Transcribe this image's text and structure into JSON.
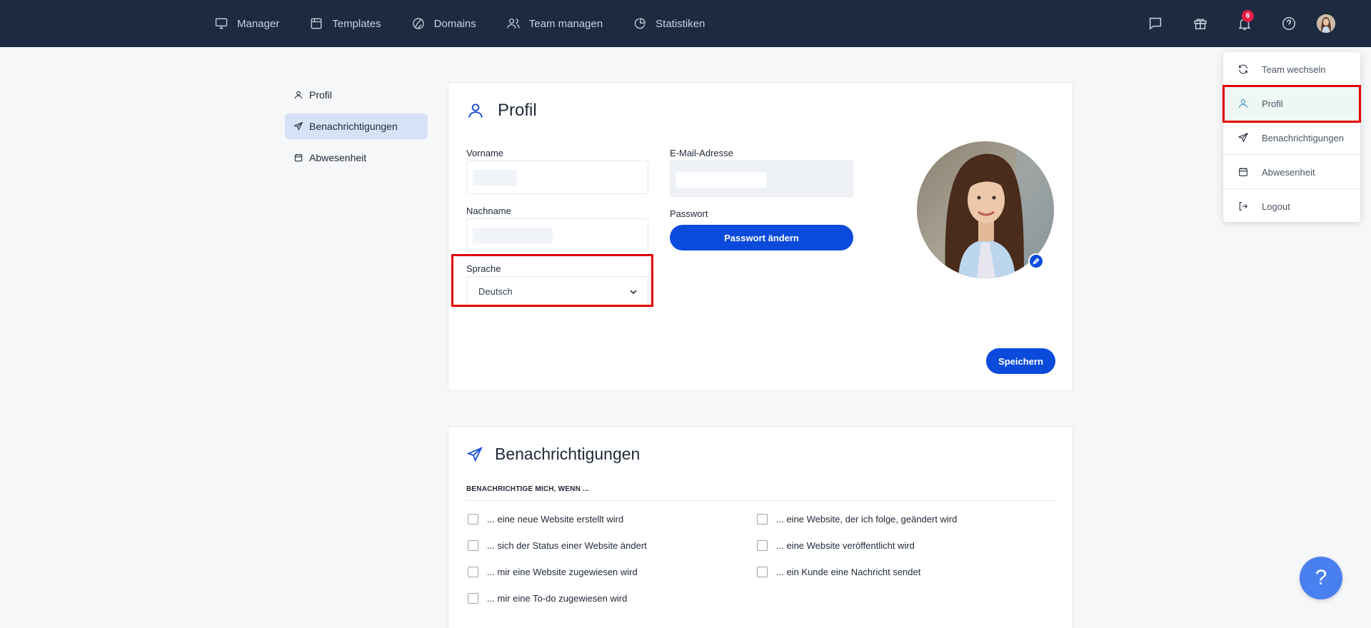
{
  "nav": {
    "items": [
      {
        "label": "Manager",
        "icon": "monitor-icon"
      },
      {
        "label": "Templates",
        "icon": "browser-window-icon"
      },
      {
        "label": "Domains",
        "icon": "globe-icon"
      },
      {
        "label": "Team managen",
        "icon": "users-icon"
      },
      {
        "label": "Statistiken",
        "icon": "pie-chart-icon"
      }
    ],
    "notification_count": "6"
  },
  "subnav": {
    "items": [
      {
        "label": "Profil",
        "active": false
      },
      {
        "label": "Benachrichtigungen",
        "active": true
      },
      {
        "label": "Abwesenheit",
        "active": false
      }
    ]
  },
  "profile": {
    "title": "Profil",
    "first_name_label": "Vorname",
    "last_name_label": "Nachname",
    "email_label": "E-Mail-Adresse",
    "password_label": "Passwort",
    "change_password_label": "Passwort ändern",
    "language_label": "Sprache",
    "language_value": "Deutsch",
    "save_label": "Speichern"
  },
  "notifications": {
    "title": "Benachrichtigungen",
    "subtitle": "BENACHRICHTIGE MICH, WENN ...",
    "options": [
      "... eine neue Website erstellt wird",
      "... eine Website, der ich folge, geändert wird",
      "... sich der Status einer Website ändert",
      "... eine Website veröffentlicht wird",
      "... mir eine Website zugewiesen wird",
      "... ein Kunde eine Nachricht sendet",
      "... mir eine To-do zugewiesen wird"
    ]
  },
  "user_menu": {
    "items": [
      {
        "label": "Team wechseln",
        "icon": "refresh-icon"
      },
      {
        "label": "Profil",
        "icon": "user-icon"
      },
      {
        "label": "Benachrichtigungen",
        "icon": "send-icon"
      },
      {
        "label": "Abwesenheit",
        "icon": "calendar-icon"
      },
      {
        "label": "Logout",
        "icon": "logout-icon"
      }
    ]
  },
  "help_label": "?",
  "colors": {
    "topbar": "#1c2b40",
    "primary": "#0b4bdc",
    "highlight": "#e00000",
    "badge": "#e11d48"
  }
}
